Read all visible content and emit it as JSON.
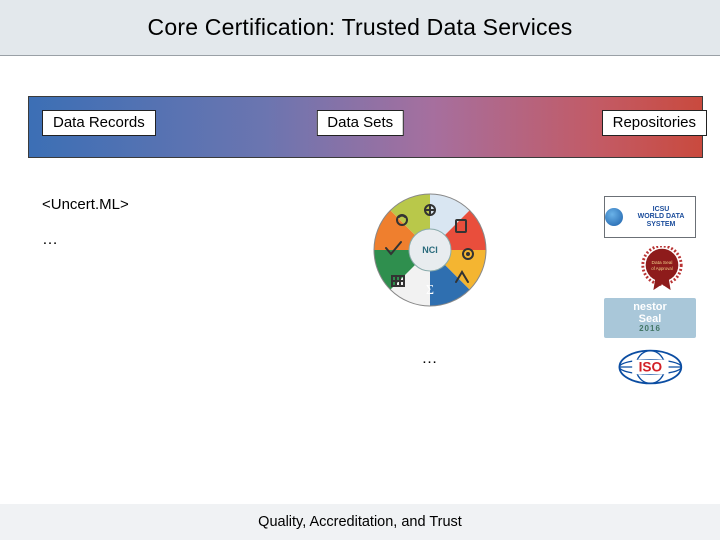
{
  "title": "Core Certification: Trusted Data Services",
  "columns": {
    "left": {
      "label": "Data Records"
    },
    "center": {
      "label": "Data Sets"
    },
    "right": {
      "label": "Repositories"
    }
  },
  "left_col": {
    "tag": "<Uncert.ML>",
    "more": "…"
  },
  "center_col": {
    "wheel_hub": "NCI",
    "more": "…"
  },
  "cert_badges": {
    "wds": {
      "line1": "ICSU",
      "line2": "WORLD DATA SYSTEM"
    },
    "seal": {
      "line1": "Data Seal",
      "line2": "of Approval"
    },
    "nestor": {
      "line1": "nestor",
      "line2": "Seal",
      "year": "2016"
    },
    "iso": {
      "label": "ISO"
    }
  },
  "footer": "Quality, Accreditation, and Trust"
}
